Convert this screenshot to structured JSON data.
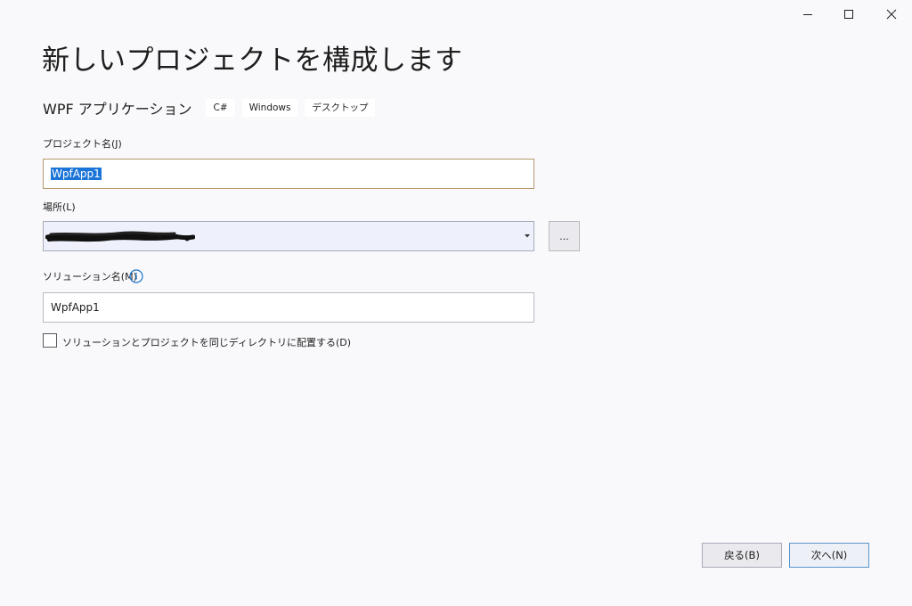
{
  "window_controls": {
    "minimize_icon": "minimize-icon",
    "maximize_icon": "maximize-icon",
    "close_icon": "close-icon"
  },
  "page": {
    "title": "新しいプロジェクトを構成します"
  },
  "template": {
    "name": "WPF アプリケーション",
    "tags": [
      "C#",
      "Windows",
      "デスクトップ"
    ]
  },
  "form": {
    "project_name": {
      "label": "プロジェクト名(J)",
      "value": "WpfApp1"
    },
    "location": {
      "label": "場所(L)",
      "value": "",
      "browse_label": "..."
    },
    "solution_name": {
      "label": "ソリューション名(M)",
      "value": "WpfApp1"
    },
    "same_directory": {
      "label": "ソリューションとプロジェクトを同じディレクトリに配置する(D)",
      "checked": false
    }
  },
  "footer": {
    "back_label": "戻る(B)",
    "next_label": "次へ(N)"
  },
  "colors": {
    "accent": "#1b74d8",
    "background": "#f9f9fb",
    "info_icon": "#1a73c9"
  }
}
